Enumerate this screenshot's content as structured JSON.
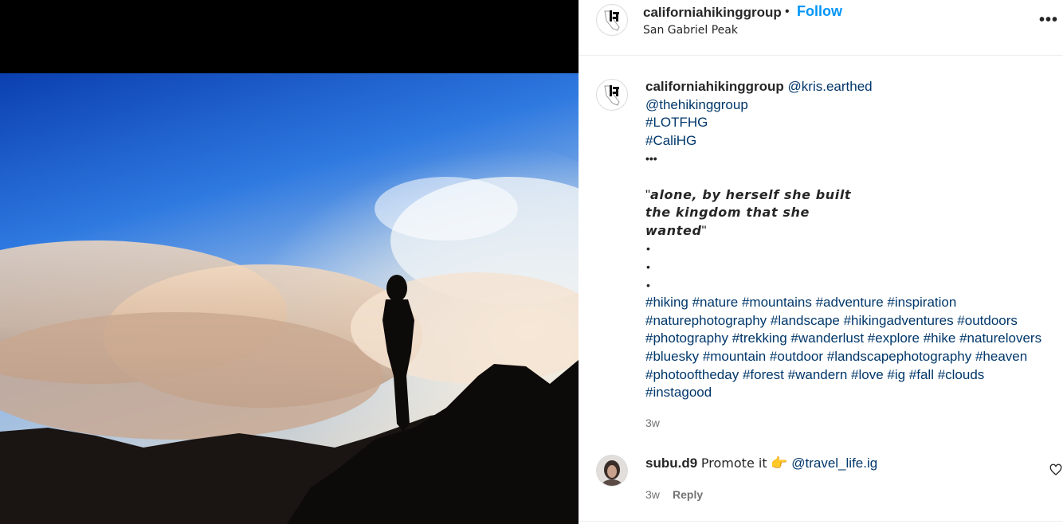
{
  "post": {
    "username": "californiahikinggroup",
    "separator": "•",
    "follow_label": "Follow",
    "location": "San Gabriel Peak",
    "more_label": "•••"
  },
  "caption": {
    "username": "californiahikinggroup",
    "mention_1": "@kris.earthed",
    "mention_2": "@thehikinggroup",
    "tag_1": "#LOTFHG",
    "tag_2": "#CaliHG",
    "dots": "•••",
    "quote_open": "\"",
    "quote_line_1": "alone, by herself she built",
    "quote_line_2": "the kingdom that she",
    "quote_line_3": "wanted",
    "quote_close": "\"",
    "bullet": "•",
    "hashtag_lines": [
      "#hiking #nature #mountains #adventure #inspiration",
      "#naturephotography #landscape #hikingadventures #outdoors",
      "#photography #trekking #wanderlust #explore #hike #naturelovers",
      "#bluesky #mountain #outdoor #landscapephotography #heaven",
      "#photooftheday #forest #wandern #love #ig #fall #clouds",
      "#instagood"
    ],
    "time": "3w"
  },
  "comment": {
    "username": "subu.d9",
    "text": "Promote it",
    "emoji": "👉",
    "mention": "@travel_life.ig",
    "time": "3w",
    "reply_label": "Reply"
  },
  "colors": {
    "follow": "#0095f6",
    "link": "#00376b",
    "meta": "#737373"
  }
}
